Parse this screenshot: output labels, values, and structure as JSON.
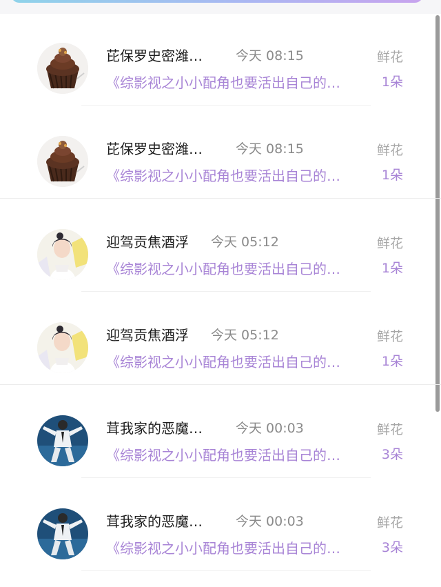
{
  "items": [
    {
      "name": "芘保罗史密潍…",
      "time": "今天 08:15",
      "gift_label": "鲜花",
      "book_title": "《综影视之小小配角也要活出自己的…",
      "count": "1朵",
      "avatar": "cupcake-avatar"
    },
    {
      "name": "芘保罗史密潍…",
      "time": "今天 08:15",
      "gift_label": "鲜花",
      "book_title": "《综影视之小小配角也要活出自己的…",
      "count": "1朵",
      "avatar": "cupcake-avatar"
    },
    {
      "name": "迎驾贡焦酒浮",
      "time": "今天 05:12",
      "gift_label": "鲜花",
      "book_title": "《综影视之小小配角也要活出自己的…",
      "count": "1朵",
      "avatar": "girl-avatar"
    },
    {
      "name": "迎驾贡焦酒浮",
      "time": "今天 05:12",
      "gift_label": "鲜花",
      "book_title": "《综影视之小小配角也要活出自己的…",
      "count": "1朵",
      "avatar": "girl-avatar"
    },
    {
      "name": "茸我家的恶魔…",
      "time": "今天 00:03",
      "gift_label": "鲜花",
      "book_title": "《综影视之小小配角也要活出自己的…",
      "count": "3朵",
      "avatar": "dancer-avatar"
    },
    {
      "name": "茸我家的恶魔…",
      "time": "今天 00:03",
      "gift_label": "鲜花",
      "book_title": "《综影视之小小配角也要活出自己的…",
      "count": "3朵",
      "avatar": "dancer-avatar"
    }
  ],
  "colors": {
    "accent": "#a884d6",
    "muted": "#a7a7a7",
    "name": "#1e1e1e"
  }
}
